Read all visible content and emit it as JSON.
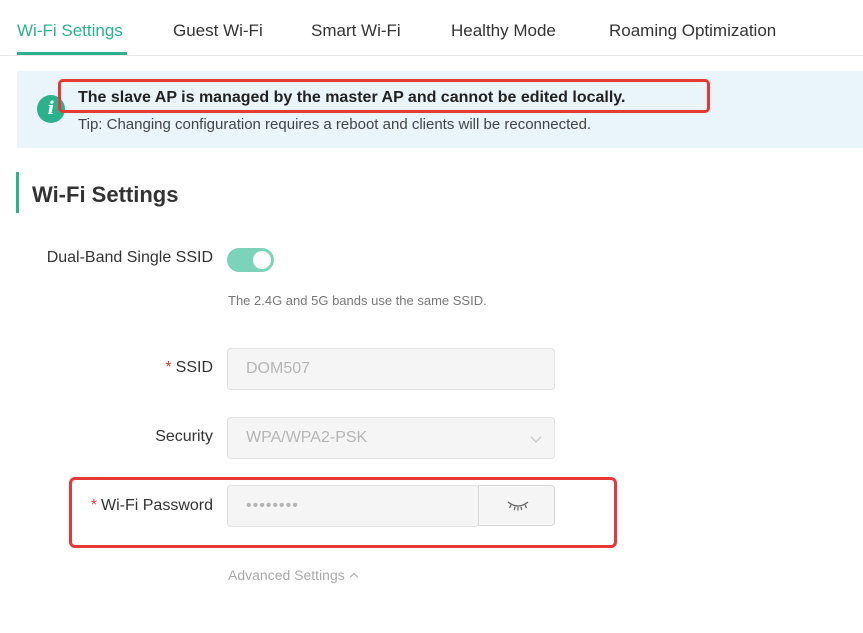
{
  "tabs": [
    {
      "label": "Wi-Fi Settings",
      "active": true
    },
    {
      "label": "Guest Wi-Fi",
      "active": false
    },
    {
      "label": "Smart Wi-Fi",
      "active": false
    },
    {
      "label": "Healthy Mode",
      "active": false
    },
    {
      "label": "Roaming Optimization",
      "active": false
    }
  ],
  "banner": {
    "icon": "info-icon",
    "icon_glyph": "i",
    "title": "The slave AP is managed by the master AP and cannot be edited locally.",
    "tip": "Tip: Changing configuration requires a reboot and clients will be reconnected."
  },
  "section": {
    "title": "Wi-Fi Settings"
  },
  "form": {
    "dual_band": {
      "label": "Dual-Band Single SSID",
      "enabled": true,
      "hint": "The 2.4G and 5G bands use the same SSID."
    },
    "ssid": {
      "required_mark": "*",
      "label": "SSID",
      "value": "DOM507"
    },
    "security": {
      "label": "Security",
      "value": "WPA/WPA2-PSK"
    },
    "password": {
      "required_mark": "*",
      "label": "Wi-Fi Password",
      "value": "••••••••",
      "toggle_icon": "eye-closed-icon"
    },
    "advanced": {
      "label": "Advanced Settings"
    }
  },
  "colors": {
    "accent": "#2bb28d",
    "highlight": "#e53935",
    "banner_bg": "#e9f4fb"
  }
}
